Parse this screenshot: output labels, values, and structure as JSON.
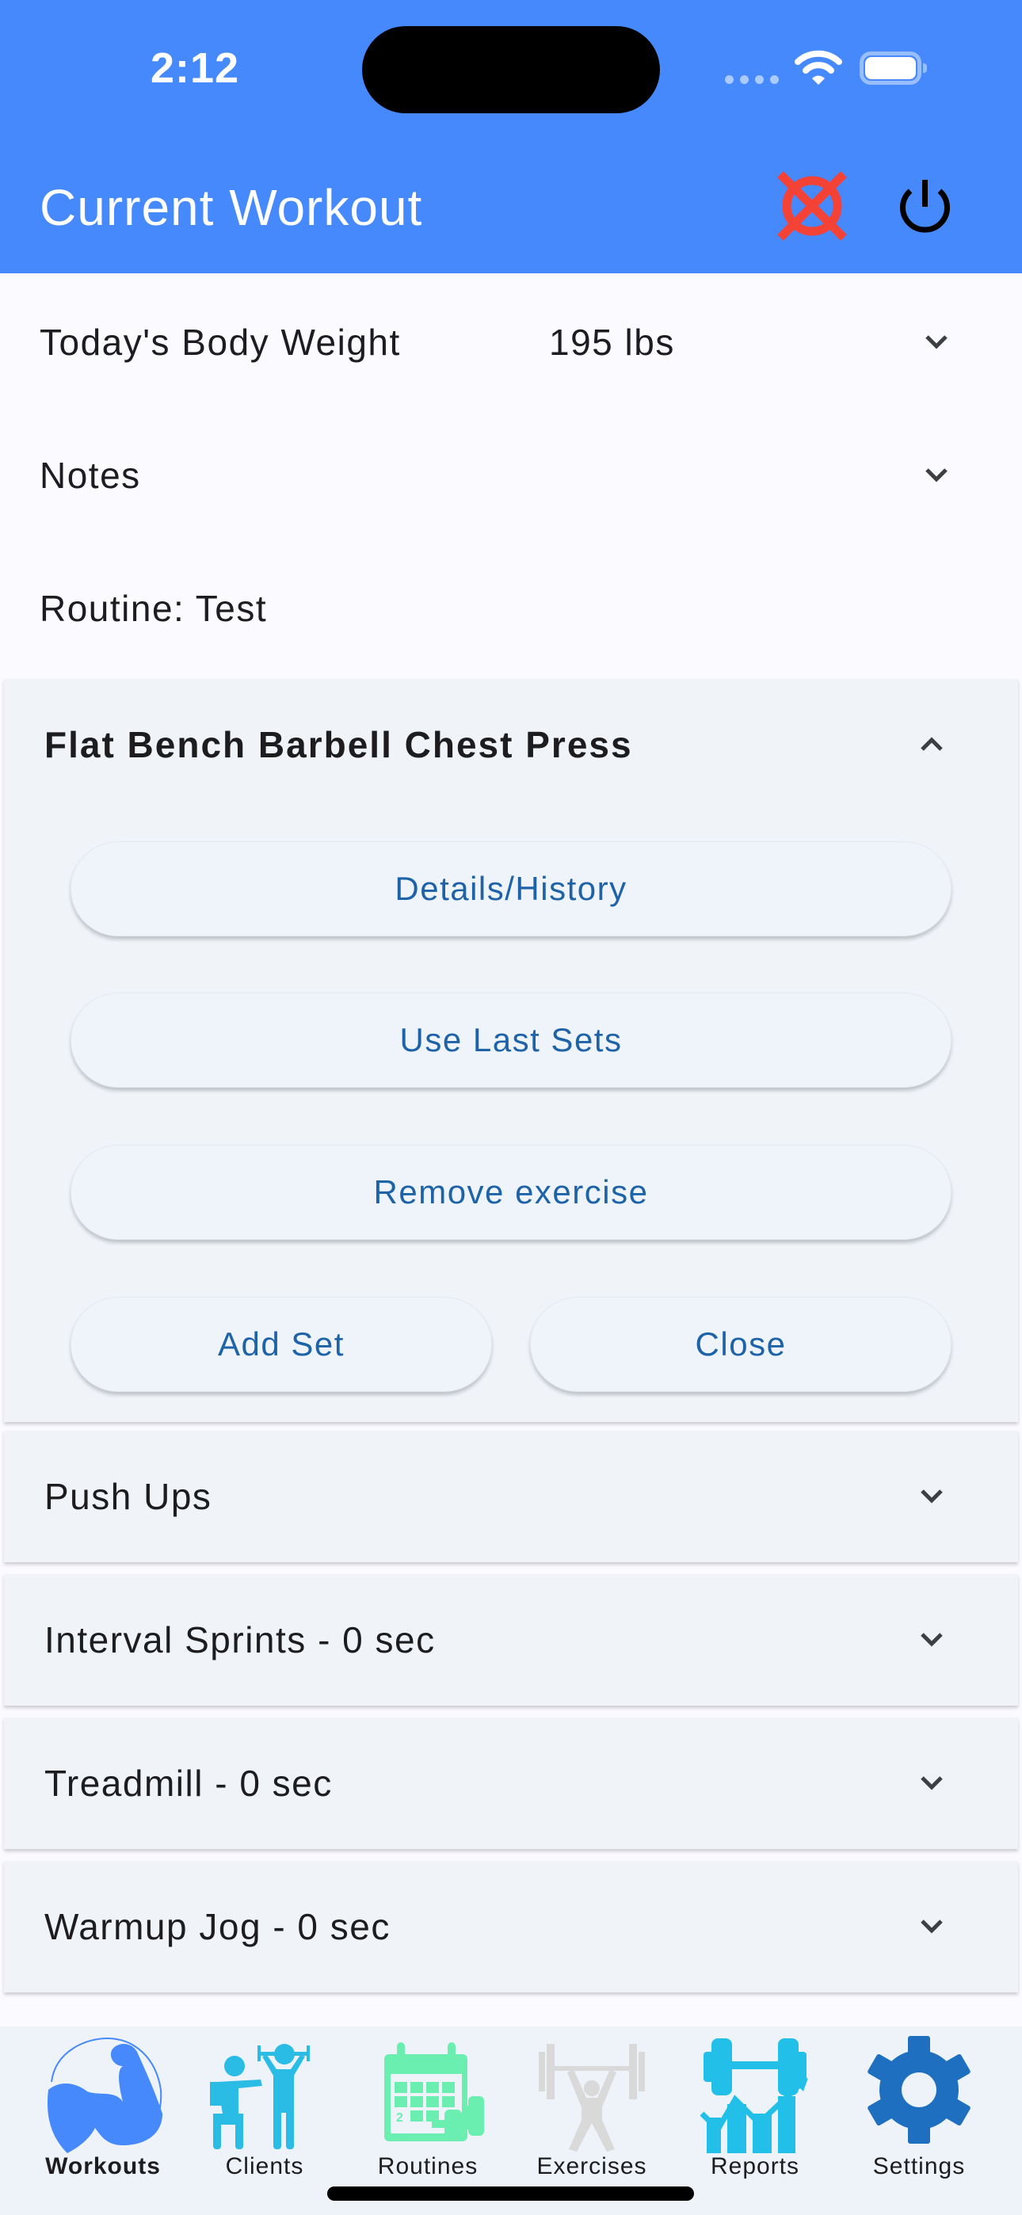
{
  "status_bar": {
    "time": "2:12"
  },
  "header": {
    "title": "Current Workout",
    "actions": [
      {
        "name": "cancel-workout",
        "icon": "cancel-x-circle-icon",
        "color": "#F44336"
      },
      {
        "name": "finish-workout",
        "icon": "power-icon",
        "color": "#000000"
      }
    ],
    "background_color": "#4589FD"
  },
  "body_weight": {
    "label": "Today's Body Weight",
    "value": "195 lbs",
    "expanded": false
  },
  "notes": {
    "label": "Notes",
    "expanded": false
  },
  "routine": {
    "label": "Routine: Test"
  },
  "exercises": [
    {
      "title": "Flat Bench Barbell Chest Press",
      "expanded": true,
      "buttons": {
        "details": "Details/History",
        "use_last_sets": "Use Last Sets",
        "remove": "Remove exercise",
        "add_set": "Add Set",
        "close": "Close"
      }
    },
    {
      "title": "Push Ups",
      "expanded": false
    },
    {
      "title": "Interval Sprints - 0 sec",
      "expanded": false
    },
    {
      "title": "Treadmill - 0 sec",
      "expanded": false
    },
    {
      "title": "Warmup Jog - 0 sec",
      "expanded": false
    }
  ],
  "bottom_nav": {
    "active": "Workouts",
    "items": [
      {
        "label": "Workouts",
        "icon": "flexed-bicep-icon",
        "color": "#4589FD"
      },
      {
        "label": "Clients",
        "icon": "trainer-client-icon",
        "color": "#2BBCE6"
      },
      {
        "label": "Routines",
        "icon": "calendar-dumbbell-icon",
        "color": "#6BEFB0"
      },
      {
        "label": "Exercises",
        "icon": "weightlifter-icon",
        "color": "#D9D9D9"
      },
      {
        "label": "Reports",
        "icon": "dumbbell-chart-icon",
        "color": "#22C0E8"
      },
      {
        "label": "Settings",
        "icon": "gear-icon",
        "color": "#1E6FC0"
      }
    ]
  },
  "colors": {
    "button_text": "#1E63A8",
    "card_bg": "#F0F4F9",
    "page_bg": "#FAFAFF"
  }
}
